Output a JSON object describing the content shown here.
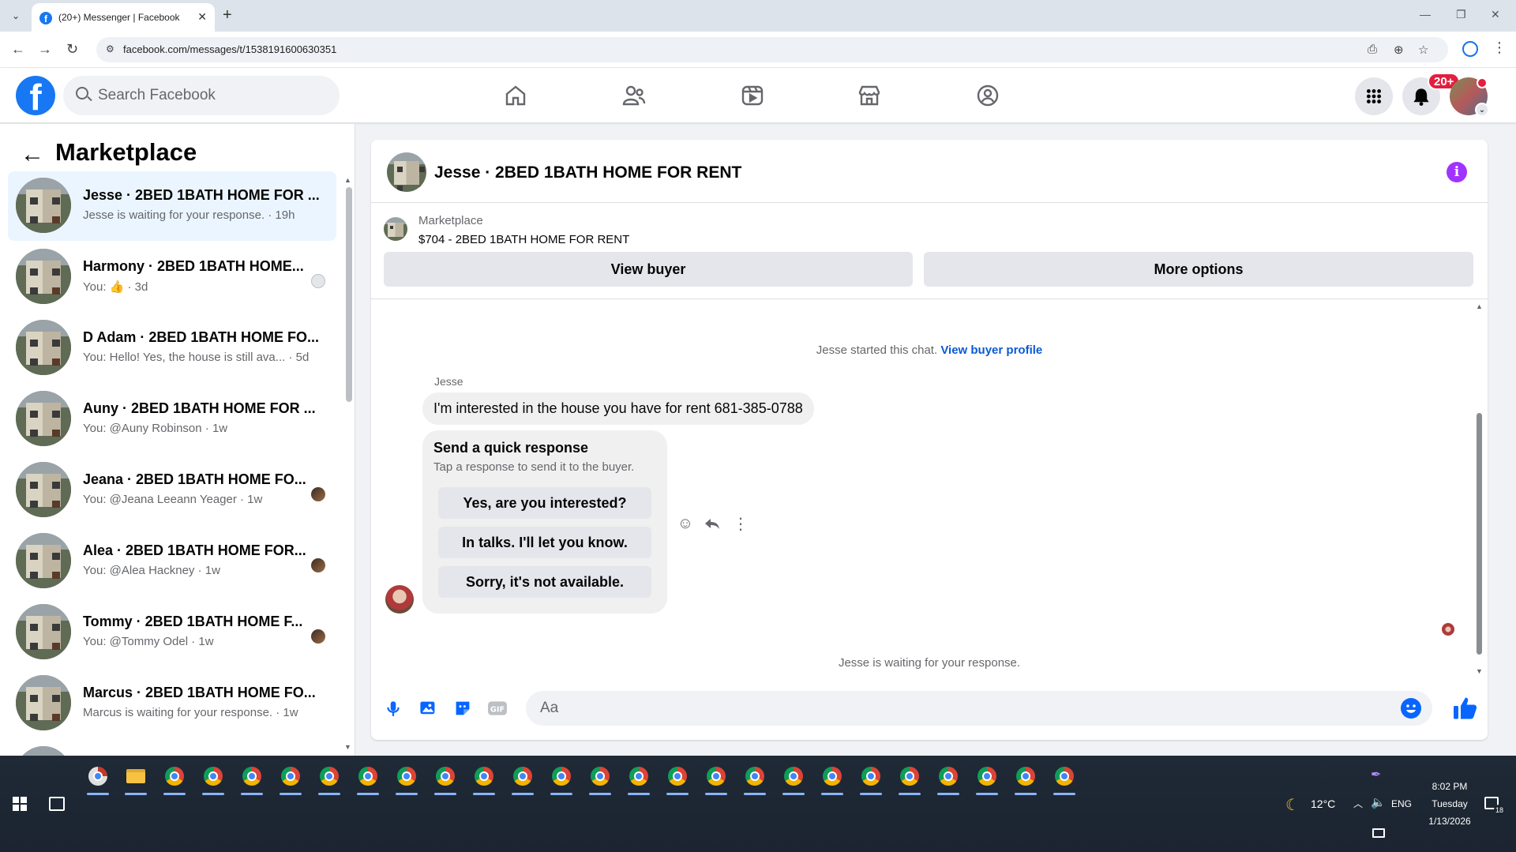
{
  "browser": {
    "tab_title": "(20+) Messenger | Facebook",
    "url": "facebook.com/messages/t/1538191600630351"
  },
  "fb": {
    "search_placeholder": "Search Facebook",
    "notifications_badge": "20+",
    "nav_icons": [
      "home-icon",
      "friends-icon",
      "video-icon",
      "marketplace-icon",
      "groups-icon"
    ]
  },
  "sidebar": {
    "title": "Marketplace",
    "conversations": [
      {
        "name": "Jesse · 2BED 1BATH HOME FOR ...",
        "preview": "Jesse is waiting for your response. · 19h",
        "active": true
      },
      {
        "name": "Harmony · 2BED 1BATH HOME...",
        "preview": "You: 👍 · 3d"
      },
      {
        "name": "D Adam · 2BED 1BATH HOME FO...",
        "preview": "You: Hello! Yes, the house is still ava... · 5d"
      },
      {
        "name": "Auny · 2BED 1BATH HOME FOR ...",
        "preview": "You: @Auny Robinson · 1w"
      },
      {
        "name": "Jeana · 2BED 1BATH HOME FO...",
        "preview": "You: @Jeana Leeann Yeager · 1w"
      },
      {
        "name": "Alea · 2BED 1BATH HOME FOR...",
        "preview": "You: @Alea Hackney · 1w"
      },
      {
        "name": "Tommy · 2BED 1BATH HOME F...",
        "preview": "You: @Tommy Odel · 1w"
      },
      {
        "name": "Marcus · 2BED 1BATH HOME FO...",
        "preview": "Marcus is waiting for your response. · 1w"
      }
    ]
  },
  "chat": {
    "title": "Jesse · 2BED 1BATH HOME FOR RENT",
    "listing_label": "Marketplace",
    "listing_price": "$704 - 2BED 1BATH HOME FOR RENT",
    "view_buyer": "View buyer",
    "more_options": "More options",
    "started_text": "Jesse started this chat.",
    "started_link": "View buyer profile",
    "sender": "Jesse",
    "message": "I'm interested in the house you have for rent 681-385-0788",
    "quick_title": "Send a quick response",
    "quick_sub": "Tap a response to send it to the buyer.",
    "quick_responses": [
      "Yes, are you interested?",
      "In talks. I'll let you know.",
      "Sorry, it's not available."
    ],
    "waiting": "Jesse is waiting for your response.",
    "input_placeholder": "Aa"
  },
  "taskbar": {
    "temperature": "12°C",
    "language": "ENG",
    "time": "8:02 PM",
    "day": "Tuesday",
    "date": "1/13/2026",
    "notification_count": "18"
  },
  "colors": {
    "fb_blue": "#1877f2",
    "link_blue": "#0a5ad4",
    "active_conv": "#ebf5ff",
    "info_purple": "#a033ff",
    "badge_red": "#e41e3f"
  }
}
